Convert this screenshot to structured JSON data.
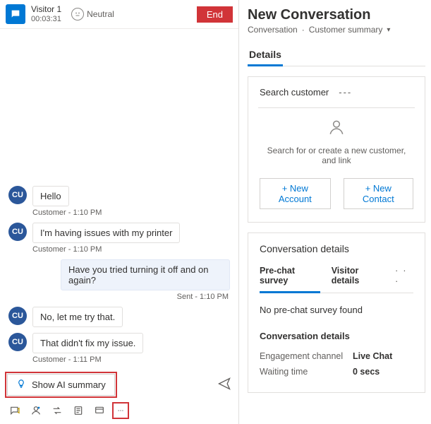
{
  "chat": {
    "visitor_name": "Visitor 1",
    "timer": "00:03:31",
    "sentiment_label": "Neutral",
    "end_label": "End",
    "customer_initials": "CU",
    "messages": [
      {
        "side": "left",
        "text": "Hello",
        "meta": "Customer - 1:10 PM"
      },
      {
        "side": "left",
        "text": "I'm having issues with my printer",
        "meta": "Customer - 1:10 PM"
      },
      {
        "side": "right",
        "text": "Have you tried turning it off and on again?",
        "meta": "Sent - 1:10 PM"
      },
      {
        "side": "left",
        "text": "No, let me try that.",
        "meta": ""
      },
      {
        "side": "left",
        "text": "That didn't fix my issue.",
        "meta": "Customer - 1:11 PM"
      }
    ],
    "ai_summary_label": "Show AI summary"
  },
  "side": {
    "title": "New Conversation",
    "crumb_conv": "Conversation",
    "crumb_summary": "Customer summary",
    "tab_details": "Details",
    "search_cust_label": "Search customer",
    "search_cust_value": "---",
    "empty_text": "Search for or create a new customer, and link",
    "btn_new_account": "+ New Account",
    "btn_new_contact": "+ New Contact",
    "conv_details_title": "Conversation details",
    "subtab_prechat": "Pre-chat survey",
    "subtab_visitor": "Visitor details",
    "no_prechat": "No pre-chat survey found",
    "section_conv_details": "Conversation details",
    "row1_k": "Engagement channel",
    "row1_v": "Live Chat",
    "row2_k": "Waiting time",
    "row2_v": "0 secs"
  }
}
